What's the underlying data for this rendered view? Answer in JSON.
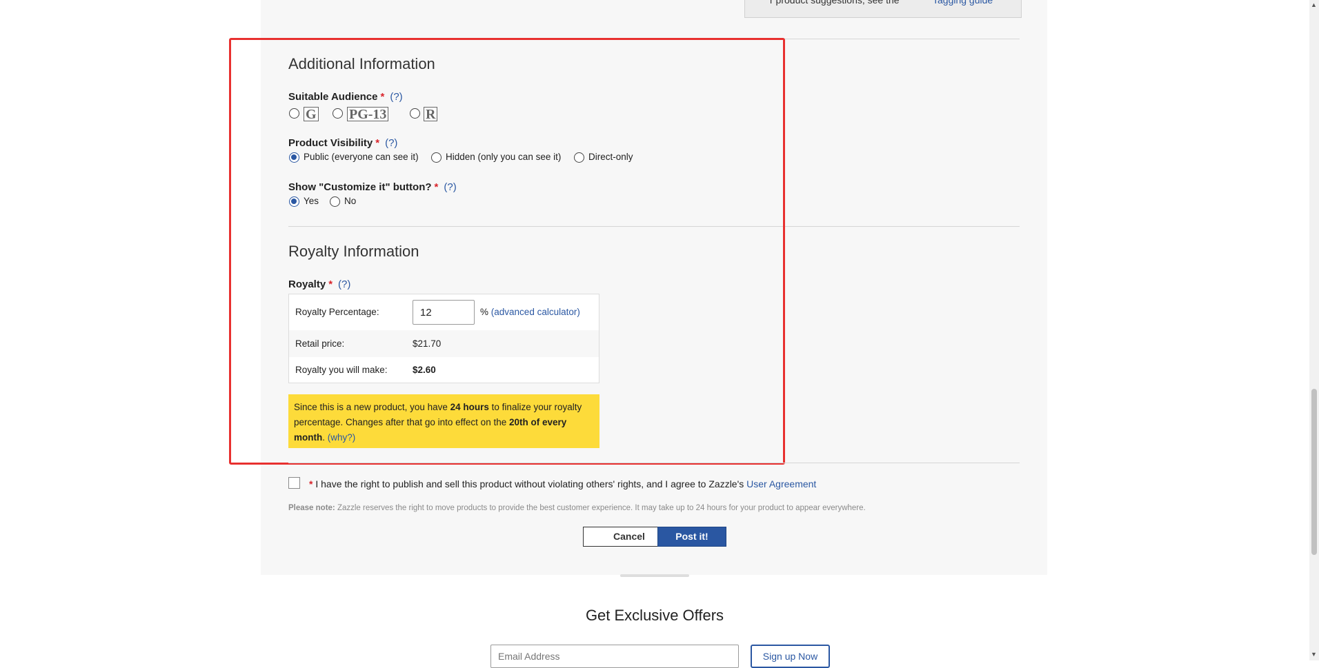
{
  "top_box": {
    "text_fragment": "r product suggestions, see the",
    "link_fragment": "Tagging guide"
  },
  "additional_info": {
    "title": "Additional Information",
    "suitable_audience": {
      "label": "Suitable Audience",
      "required_mark": "*",
      "help": "(?)",
      "ratings": [
        "G",
        "PG-13",
        "R"
      ]
    },
    "product_visibility": {
      "label": "Product Visibility",
      "required_mark": "*",
      "help": "(?)",
      "options": [
        "Public (everyone can see it)",
        "Hidden (only you can see it)",
        "Direct-only"
      ],
      "selected": "Public (everyone can see it)"
    },
    "customize_button": {
      "label": "Show \"Customize it\" button?",
      "required_mark": "*",
      "help": "(?)",
      "options": [
        "Yes",
        "No"
      ],
      "selected": "Yes"
    }
  },
  "royalty_info": {
    "title": "Royalty Information",
    "label": "Royalty",
    "required_mark": "*",
    "help": "(?)",
    "percentage_label": "Royalty Percentage:",
    "percentage_value": "12",
    "percent_sign": "%",
    "calculator_link": "(advanced calculator)",
    "retail_label": "Retail price:",
    "retail_value": "$21.70",
    "earn_label": "Royalty you will make:",
    "earn_value": "$2.60",
    "notice": {
      "p1": "Since this is a new product, you have ",
      "b1": "24 hours",
      "p2": " to finalize your royalty percentage. Changes after that go into effect on the ",
      "b2": "20th of every month",
      "p3": ". ",
      "link": "(why?)"
    }
  },
  "agreement": {
    "required_mark": "*",
    "text": " I have the right to publish and sell this product without violating others' rights, and I agree to Zazzle's ",
    "link": "User Agreement"
  },
  "please_note": {
    "bold": "Please note:",
    "text": " Zazzle reserves the right to move products to provide the best customer experience. It may take up to 24 hours for your product to appear everywhere."
  },
  "buttons": {
    "cancel": "Cancel",
    "post": "Post it!"
  },
  "footer": {
    "title": "Get Exclusive Offers",
    "email_placeholder": "Email Address",
    "signup": "Sign up Now"
  },
  "colors": {
    "accent": "#2a57a2",
    "required": "#d9242b",
    "notice_bg": "#fddb3a",
    "highlight_box": "#e8302f"
  }
}
